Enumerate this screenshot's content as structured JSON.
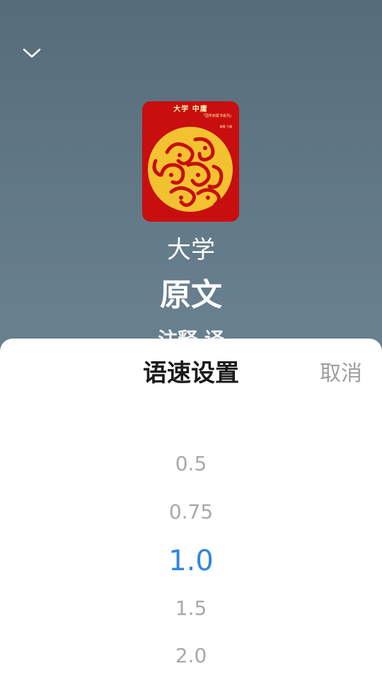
{
  "book": {
    "cover_title": "大学 中庸",
    "cover_series": "「国学启蒙书系列」",
    "cover_author": "编著 主编",
    "title": "大学",
    "section": "原文",
    "peek_text": "注释 译"
  },
  "speed_sheet": {
    "title": "语速设置",
    "cancel_label": "取消",
    "options": [
      "0.5",
      "0.75",
      "1.0",
      "1.5",
      "2.0"
    ],
    "selected": "1.0"
  },
  "colors": {
    "accent": "#2f86e0",
    "cover_red": "#c80e0e",
    "cover_gold": "#f3c230"
  }
}
